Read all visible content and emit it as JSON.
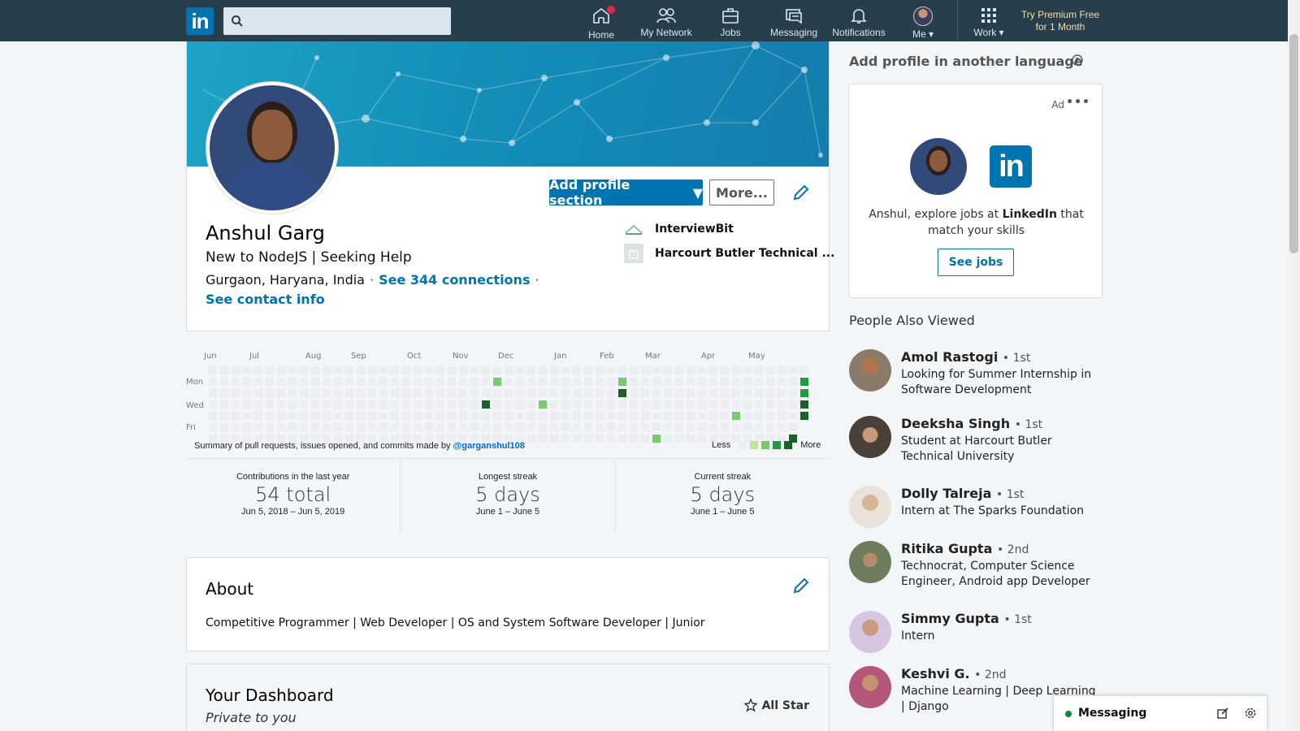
{
  "nav": {
    "logo": "in",
    "search_placeholder": "",
    "items": [
      {
        "label": "Home",
        "icon": "home-icon",
        "badge": true
      },
      {
        "label": "My Network",
        "icon": "network-icon"
      },
      {
        "label": "Jobs",
        "icon": "jobs-icon"
      },
      {
        "label": "Messaging",
        "icon": "messaging-icon"
      },
      {
        "label": "Notifications",
        "icon": "notifications-icon"
      },
      {
        "label": "Me",
        "icon": "me-avatar"
      },
      {
        "label": "Work",
        "icon": "grid-icon"
      }
    ],
    "premium_line1": "Try Premium Free",
    "premium_line2": "for 1 Month"
  },
  "profile": {
    "name": "Anshul Garg",
    "headline": "New to NodeJS | Seeking Help",
    "location": "Gurgaon, Haryana, India",
    "connections": "See 344 connections",
    "contact": "See contact info",
    "add_section": "Add profile section",
    "more": "More...",
    "company": "InterviewBit",
    "school": "Harcourt Butler Technical ..."
  },
  "contributions": {
    "months": [
      "Jun",
      "Jul",
      "Aug",
      "Sep",
      "Oct",
      "Nov",
      "Dec",
      "Jan",
      "Feb",
      "Mar",
      "Apr",
      "May"
    ],
    "days": [
      "Mon",
      "Wed",
      "Fri"
    ],
    "summary_prefix": "Summary of pull requests, issues opened, and commits made by",
    "handle": "@garganshul108",
    "legend_less": "Less",
    "legend_more": "More",
    "colors": [
      "#ebedf0",
      "#c6e48b",
      "#7bc96f",
      "#239a3b",
      "#196127"
    ],
    "active_cells": [
      {
        "week": 25,
        "day": 1,
        "level": 2
      },
      {
        "week": 24,
        "day": 3,
        "level": 4
      },
      {
        "week": 29,
        "day": 3,
        "level": 2
      },
      {
        "week": 36,
        "day": 1,
        "level": 2
      },
      {
        "week": 36,
        "day": 2,
        "level": 4
      },
      {
        "week": 39,
        "day": 6,
        "level": 2
      },
      {
        "week": 46,
        "day": 4,
        "level": 2
      },
      {
        "week": 51,
        "day": 6,
        "level": 4
      },
      {
        "week": 52,
        "day": 1,
        "level": 3
      },
      {
        "week": 52,
        "day": 2,
        "level": 3
      },
      {
        "week": 52,
        "day": 3,
        "level": 4
      },
      {
        "week": 52,
        "day": 4,
        "level": 4
      }
    ],
    "stats": [
      {
        "title": "Contributions in the last year",
        "value": "54 total",
        "range": "Jun 5, 2018 – Jun 5, 2019"
      },
      {
        "title": "Longest streak",
        "value": "5 days",
        "range": "June 1 – June 5"
      },
      {
        "title": "Current streak",
        "value": "5 days",
        "range": "June 1 – June 5"
      }
    ]
  },
  "about": {
    "title": "About",
    "text": "Competitive Programmer | Web Developer | OS and System Software Developer | Junior"
  },
  "dashboard": {
    "title": "Your Dashboard",
    "subtitle": "Private to you",
    "badge": "All Star"
  },
  "rail": {
    "language_title": "Add profile in another language",
    "ad_label": "Ad",
    "ad_text_1": "Anshul, explore jobs at",
    "ad_text_brand": "LinkedIn",
    "ad_text_2": "that match your skills",
    "ad_button": "See jobs",
    "people_title": "People Also Viewed",
    "people": [
      {
        "name": "Amol Rastogi",
        "degree": "• 1st",
        "desc": "Looking for Summer Internship in Software Development",
        "color": "#7a5a3e"
      },
      {
        "name": "Deeksha Singh",
        "degree": "• 1st",
        "desc": "Student at Harcourt Butler Technical University",
        "color": "#5a4f44"
      },
      {
        "name": "Dolly Talreja",
        "degree": "• 1st",
        "desc": "Intern at The Sparks Foundation",
        "color": "#c8a88c"
      },
      {
        "name": "Ritika Gupta",
        "degree": "• 2nd",
        "desc": "Technocrat, Computer Science Engineer, Android app Developer",
        "color": "#6f7b5a"
      },
      {
        "name": "Simmy Gupta",
        "degree": "• 1st",
        "desc": "Intern",
        "color": "#a3708f"
      },
      {
        "name": "Keshvi G.",
        "degree": "• 2nd",
        "desc": "Machine Learning | Deep Learning | Django",
        "color": "#b4557a"
      }
    ]
  },
  "messaging": {
    "label": "Messaging"
  }
}
